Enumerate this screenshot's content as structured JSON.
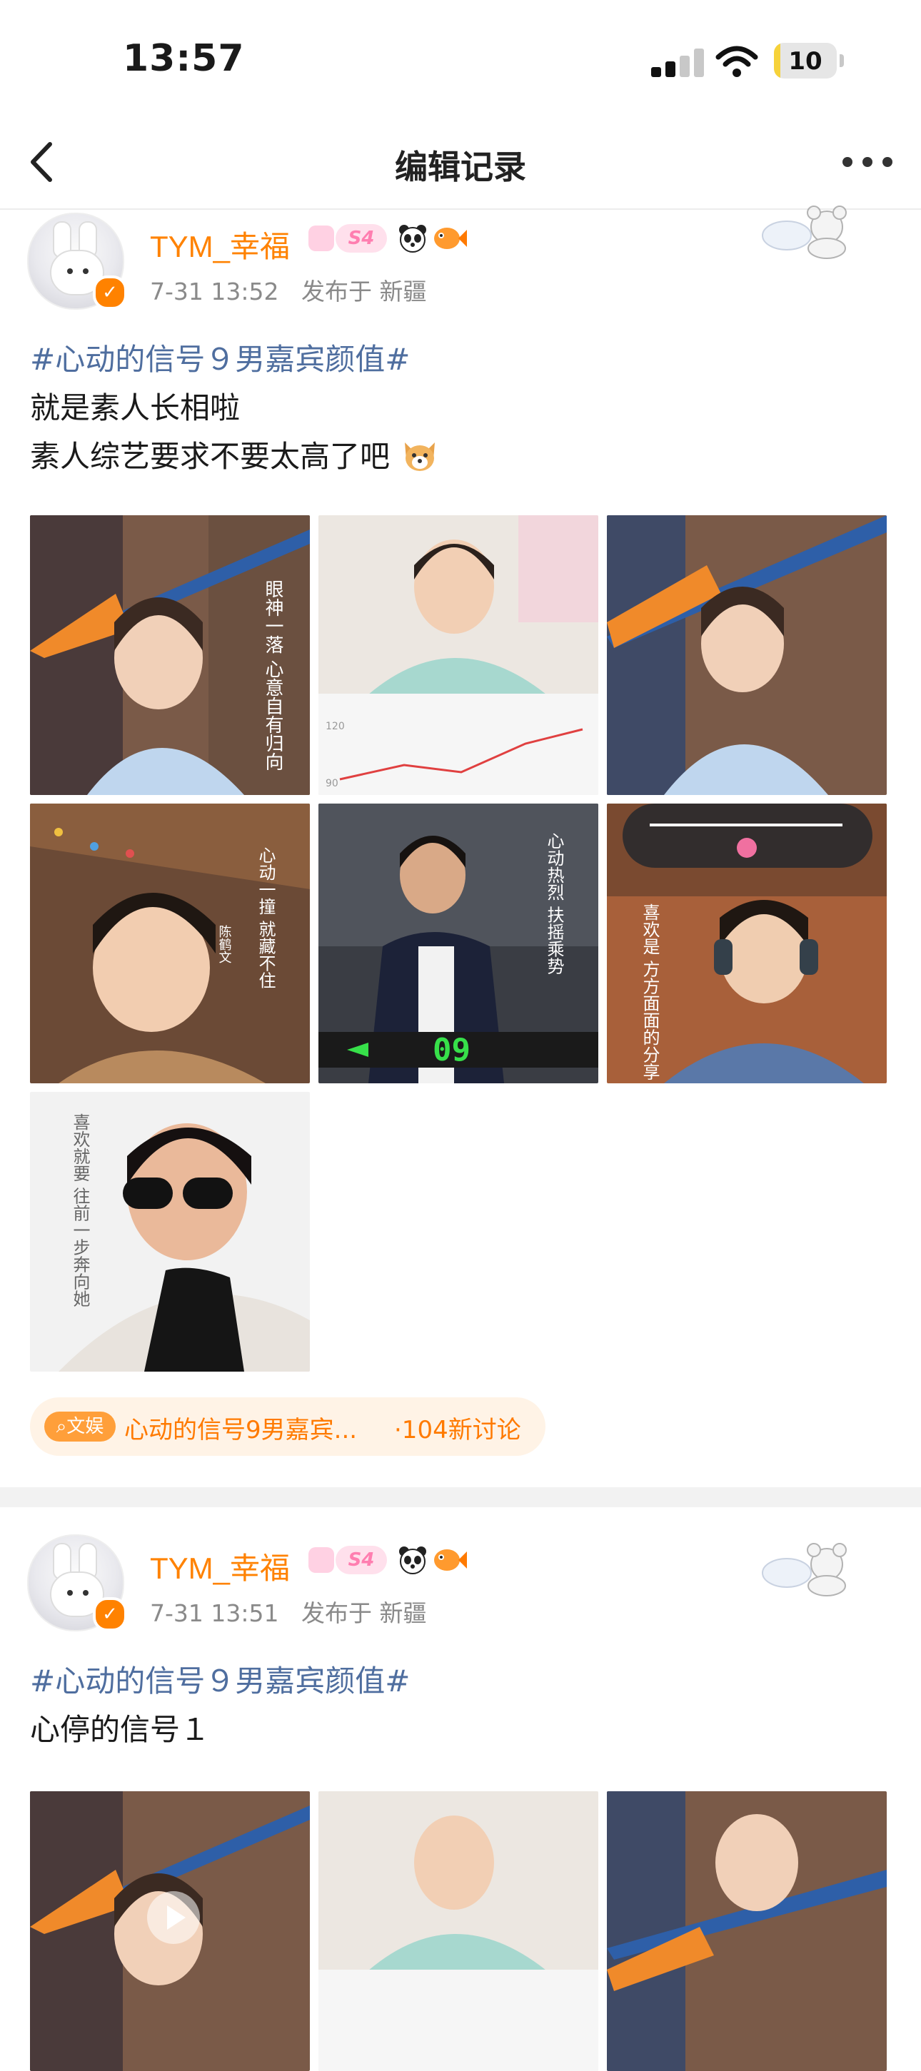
{
  "status_bar": {
    "time": "13:57",
    "battery": "10",
    "battery_level": 0.1
  },
  "nav": {
    "title": "编辑记录"
  },
  "posts": [
    {
      "user": {
        "name": "TYM_幸福",
        "level": "S4"
      },
      "meta": {
        "time": "7-31 13:52",
        "location": "发布于 新疆"
      },
      "topic": "#心动的信号９男嘉宾颜值#",
      "lines": [
        "就是素人长相啦",
        "素人综艺要求不要太高了吧"
      ],
      "image_count": 7,
      "image_texts": [
        "眼神一落 心意自有归向",
        "心动一撞 就藏不住",
        "陈鹤文",
        "心动热烈 扶摇乘势",
        "09",
        "喜欢是 方方面面的分享",
        "喜欢就要 往前一步奔向她"
      ],
      "topic_card": {
        "chip": "文娱",
        "name": "心动的信号9男嘉宾...",
        "count": "·104新讨论"
      }
    },
    {
      "user": {
        "name": "TYM_幸福",
        "level": "S4"
      },
      "meta": {
        "time": "7-31 13:51",
        "location": "发布于 新疆"
      },
      "topic": "#心动的信号９男嘉宾颜值#",
      "lines": [
        "心停的信号１"
      ]
    }
  ],
  "colors": {
    "accent": "#ff8200",
    "topic": "#4f6e9f",
    "meta": "#8a8a8a"
  }
}
